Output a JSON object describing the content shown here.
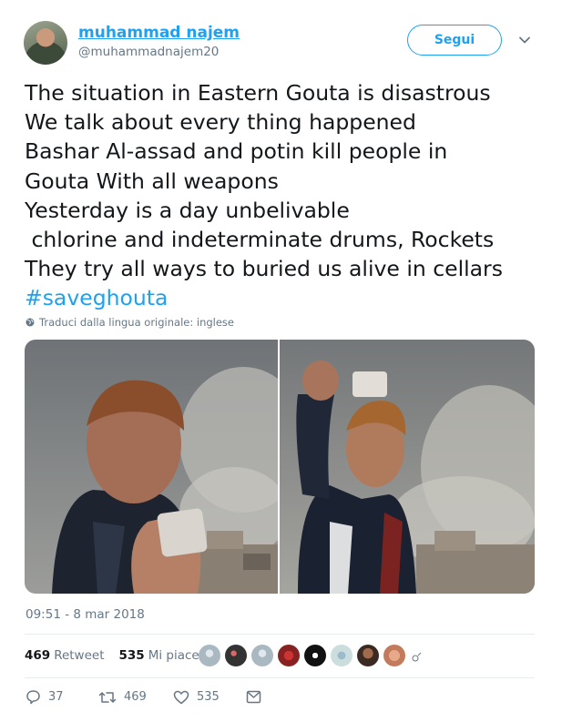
{
  "user": {
    "name": "muhammad najem",
    "handle": "@muhammadnajem20"
  },
  "follow_button": "Segui",
  "tweet": {
    "lines": [
      "The situation in Eastern Gouta is disastrous",
      "We talk about every thing happened",
      "Bashar Al-assad and potin kill people in",
      "Gouta With all weapons",
      "Yesterday is a day unbelivable",
      " chlorine and indeterminate drums, Rockets",
      "They try all ways to buried us alive in cellars"
    ],
    "hashtag": "#saveghouta"
  },
  "translate_label": "Traduci dalla lingua originale: inglese",
  "timestamp": "09:51 - 8 mar 2018",
  "stats": {
    "retweets_count": "469",
    "retweets_label": "Retweet",
    "likes_count": "535",
    "likes_label": "Mi piace"
  },
  "actions": {
    "replies": "37",
    "retweets": "469",
    "likes": "535"
  },
  "colors": {
    "accent": "#1da1f2",
    "secondary_text": "#657786",
    "divider": "#e6ecf0"
  },
  "icons": [
    "globe-icon",
    "chevron-down-icon",
    "reply-icon",
    "retweet-icon",
    "heart-icon",
    "message-icon"
  ]
}
